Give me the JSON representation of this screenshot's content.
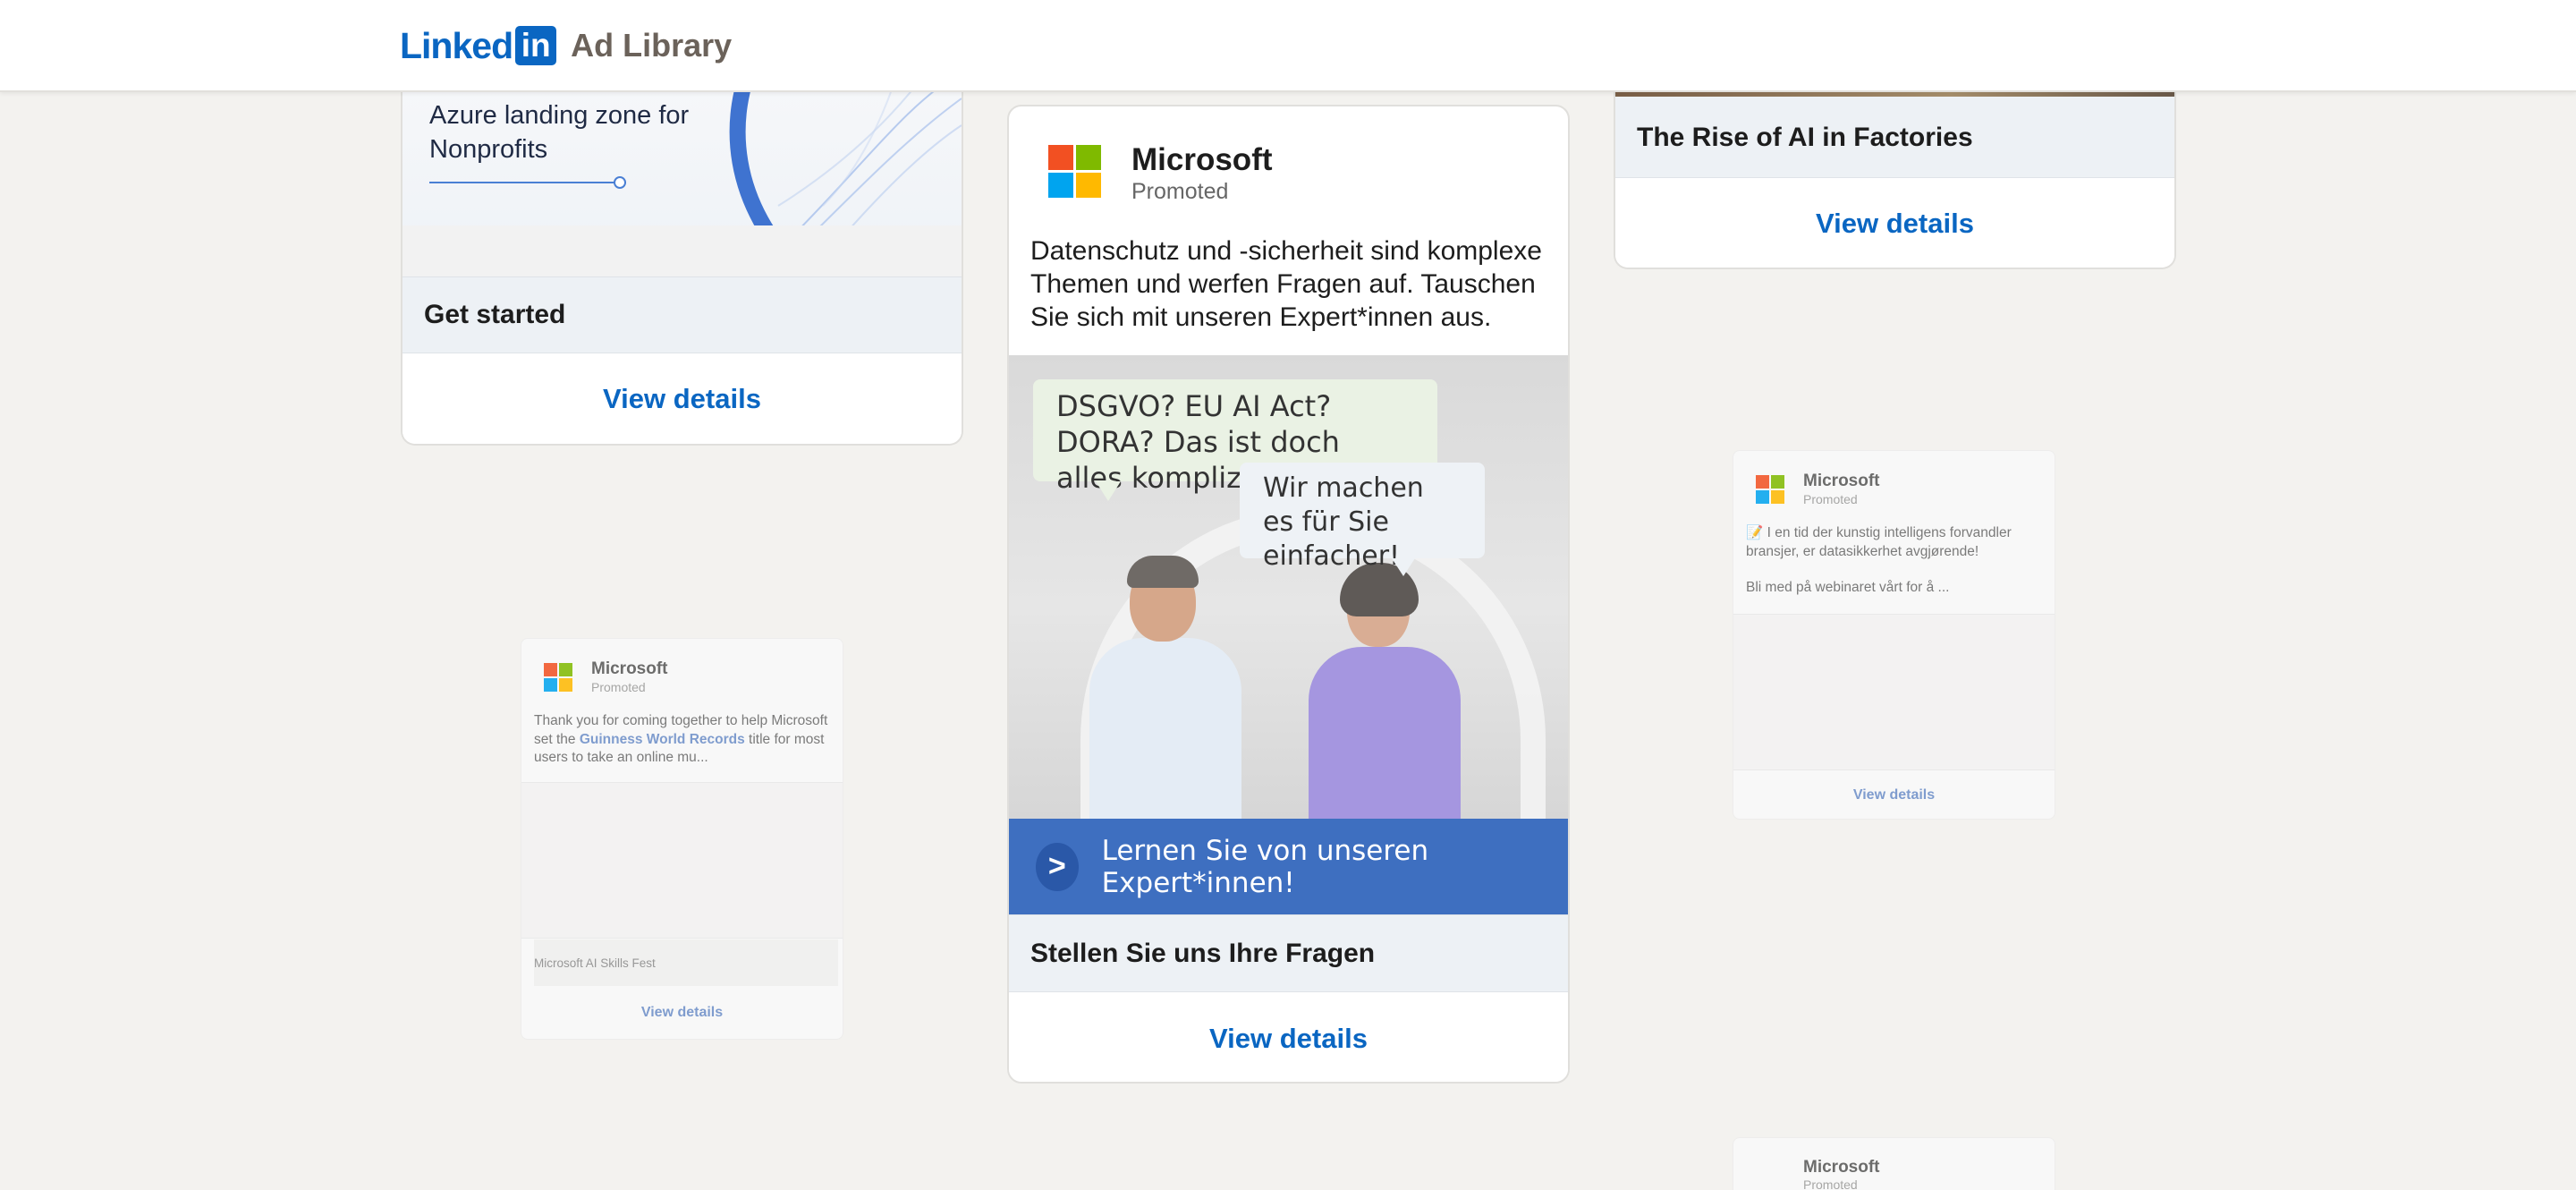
{
  "header": {
    "logo_linked": "Linked",
    "logo_in": "in",
    "logo_adlib": "Ad Library"
  },
  "card1": {
    "image_title": "Azure landing zone for Nonprofits",
    "headline": "Get started",
    "view_details": "View details"
  },
  "card2": {
    "advertiser": "Microsoft",
    "promoted": "Promoted",
    "text": "Datenschutz und -sicherheit sind komplexe Themen und werfen Fragen auf. Tauschen Sie sich mit unseren Expert*innen aus.",
    "bubble1": "DSGVO? EU AI Act? DORA? Das ist doch alles kompliziert.",
    "bubble2": "Wir machen es für Sie einfacher!",
    "cta_arrow": ">",
    "cta": "Lernen Sie von unseren Expert*innen!",
    "headline": "Stellen Sie uns Ihre Fragen",
    "view_details": "View details"
  },
  "card3": {
    "headline": "The Rise of AI in Factories",
    "view_details": "View details"
  },
  "mini1": {
    "advertiser": "Microsoft",
    "promoted": "Promoted",
    "text_a": "Thank you for coming together to help Microsoft set the ",
    "text_link": "Guinness World Records",
    "text_b": " title for most users to take an online mu...",
    "caption": "Microsoft AI Skills Fest",
    "view_details": "View details"
  },
  "mini2": {
    "advertiser": "Microsoft",
    "promoted": "Promoted",
    "text_a": "📝 I en tid der kunstig intelligens forvandler bransjer, er datasikkerhet avgjørende!",
    "text_b": "Bli med på webinaret vårt for å ...",
    "view_details": "View details"
  },
  "mini3": {
    "advertiser": "Microsoft",
    "promoted": "Promoted"
  },
  "colors": {
    "linkedin_blue": "#0a66c2",
    "background": "#f3f2ef",
    "headline_bar": "#edf1f5",
    "cta_blue": "#3e6fc0",
    "ms_red": "#f25022",
    "ms_green": "#7fba00",
    "ms_blue": "#00a4ef",
    "ms_yellow": "#ffb900"
  },
  "icons": [
    "linkedin-logo-icon",
    "microsoft-logo-icon",
    "chevron-right-icon"
  ]
}
